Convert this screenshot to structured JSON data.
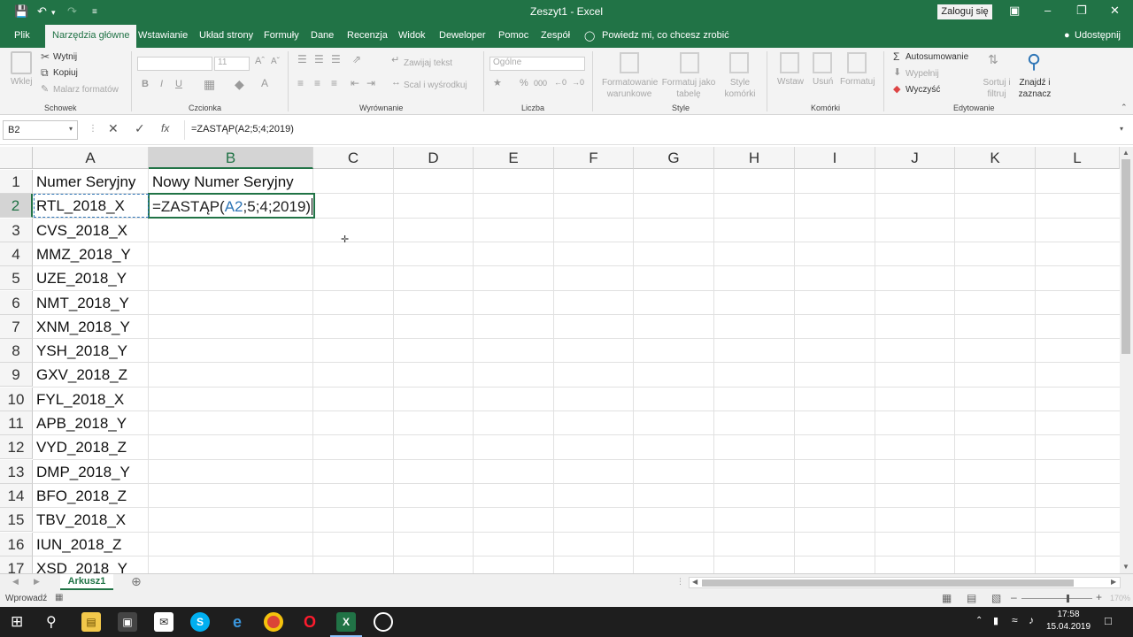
{
  "window": {
    "title": "Zeszyt1 - Excel",
    "login_label": "Zaloguj się",
    "undo_icon": "undo-icon",
    "redo_icon": "redo-icon"
  },
  "tabs": [
    "Plik",
    "Narzędzia główne",
    "Wstawianie",
    "Układ strony",
    "Formuły",
    "Dane",
    "Recenzja",
    "Widok",
    "Deweloper",
    "Pomoc",
    "Zespół"
  ],
  "active_tab": "Narzędzia główne",
  "tell_me": "Powiedz mi, co chcesz zrobić",
  "share": "Udostępnij",
  "ribbon": {
    "clipboard": {
      "paste": "Wklej",
      "cut": "Wytnij",
      "copy": "Kopiuj",
      "format_painter": "Malarz formatów",
      "label": "Schowek"
    },
    "font": {
      "size": "11",
      "label": "Czcionka",
      "bold": "B",
      "italic": "I",
      "underline": "U"
    },
    "alignment": {
      "wrap": "Zawijaj tekst",
      "merge": "Scal i wyśrodkuj",
      "label": "Wyrównanie"
    },
    "number": {
      "format": "Ogólne",
      "label": "Liczba"
    },
    "styles": {
      "conditional": "Formatowanie warunkowe",
      "table": "Formatuj jako tabelę",
      "cell_styles": "Style komórki",
      "label": "Style"
    },
    "cells": {
      "insert": "Wstaw",
      "delete": "Usuń",
      "format": "Formatuj",
      "label": "Komórki"
    },
    "editing": {
      "autosum": "Autosumowanie",
      "fill": "Wypełnij",
      "clear": "Wyczyść",
      "sort": "Sortuj i filtruj",
      "find": "Znajdź i zaznacz",
      "label": "Edytowanie"
    }
  },
  "formula_bar": {
    "name_box": "B2",
    "formula": "=ZASTĄP(A2;5;4;2019)"
  },
  "columns": [
    "A",
    "B",
    "C",
    "D",
    "E",
    "F",
    "G",
    "H",
    "I",
    "J",
    "K",
    "L"
  ],
  "rows": [
    "1",
    "2",
    "3",
    "4",
    "5",
    "6",
    "7",
    "8",
    "9",
    "10",
    "11",
    "12",
    "13",
    "14",
    "15",
    "16",
    "17"
  ],
  "cells": {
    "A1": "Numer Seryjny",
    "B1": "Nowy Numer Seryjny",
    "A": [
      "RTL_2018_X",
      "CVS_2018_X",
      "MMZ_2018_Y",
      "UZE_2018_Y",
      "NMT_2018_Y",
      "XNM_2018_Y",
      "YSH_2018_Y",
      "GXV_2018_Z",
      "FYL_2018_X",
      "APB_2018_Y",
      "VYD_2018_Z",
      "DMP_2018_Y",
      "BFO_2018_Z",
      "TBV_2018_X",
      "IUN_2018_Z",
      "XSD_2018_Y"
    ],
    "B2_edit": {
      "prefix": "=ZASTĄP(",
      "ref": "A2",
      "suffix": ";5;4;2019)"
    }
  },
  "sheet_tab": "Arkusz1",
  "status": {
    "mode": "Wprowadź",
    "zoom": "170%"
  },
  "taskbar": {
    "time": "17:58",
    "date": "15.04.2019"
  },
  "colors": {
    "excel_green": "#217346",
    "ref_blue": "#2e75b6"
  }
}
